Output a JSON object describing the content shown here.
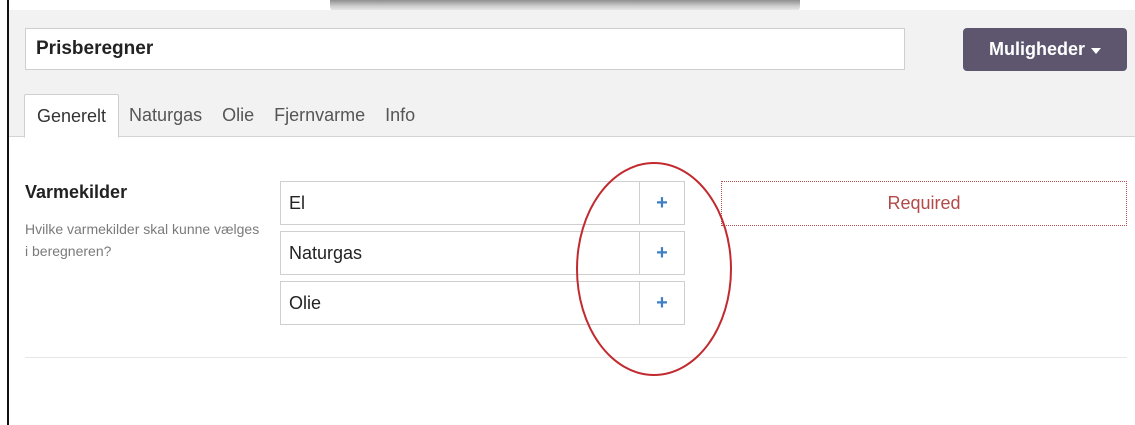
{
  "header": {
    "title_value": "Prisberegner",
    "options_button_label": "Muligheder",
    "caret_icon": "caret-down-icon"
  },
  "tabs": [
    {
      "label": "Generelt",
      "active": true
    },
    {
      "label": "Naturgas",
      "active": false
    },
    {
      "label": "Olie",
      "active": false
    },
    {
      "label": "Fjernvarme",
      "active": false
    },
    {
      "label": "Info",
      "active": false
    }
  ],
  "section": {
    "label": "Varmekilder",
    "help": "Hvilke varmekilder skal kunne vælges i beregneren?"
  },
  "options": [
    {
      "label": "El",
      "add_symbol": "+"
    },
    {
      "label": "Naturgas",
      "add_symbol": "+"
    },
    {
      "label": "Olie",
      "add_symbol": "+"
    }
  ],
  "validation": {
    "message": "Required"
  },
  "colors": {
    "primary_button": "#5d566e",
    "add_icon": "#3f7fc4",
    "error_text": "#b34a4a",
    "annotation": "#c12a2f"
  }
}
